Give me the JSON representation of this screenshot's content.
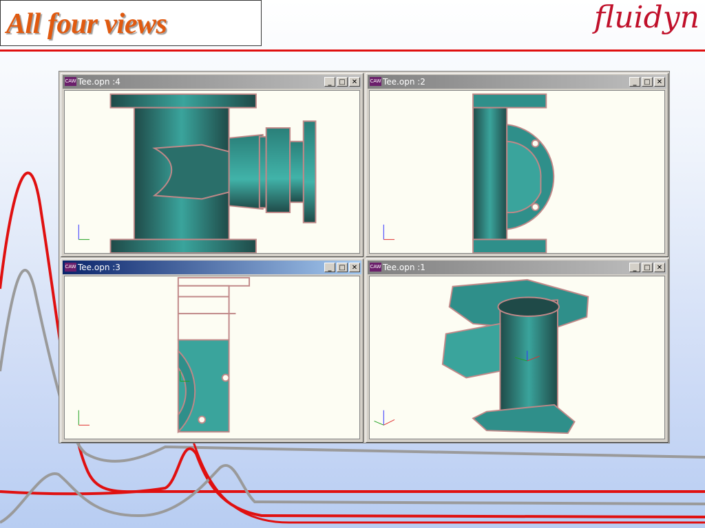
{
  "slide": {
    "title": "All four views",
    "logo": "fluidyn"
  },
  "windows": [
    {
      "title": "Tee.opn :4",
      "active": false
    },
    {
      "title": "Tee.opn :2",
      "active": false
    },
    {
      "title": "Tee.opn :3",
      "active": true
    },
    {
      "title": "Tee.opn :1",
      "active": false
    }
  ],
  "app_icon_label": "CAW",
  "colors": {
    "title": "#e05a10",
    "rule": "#e01010",
    "logo": "#c0102a",
    "part": "#2f8f8a",
    "edge": "#c08888",
    "viewport": "#fdfdf3"
  }
}
